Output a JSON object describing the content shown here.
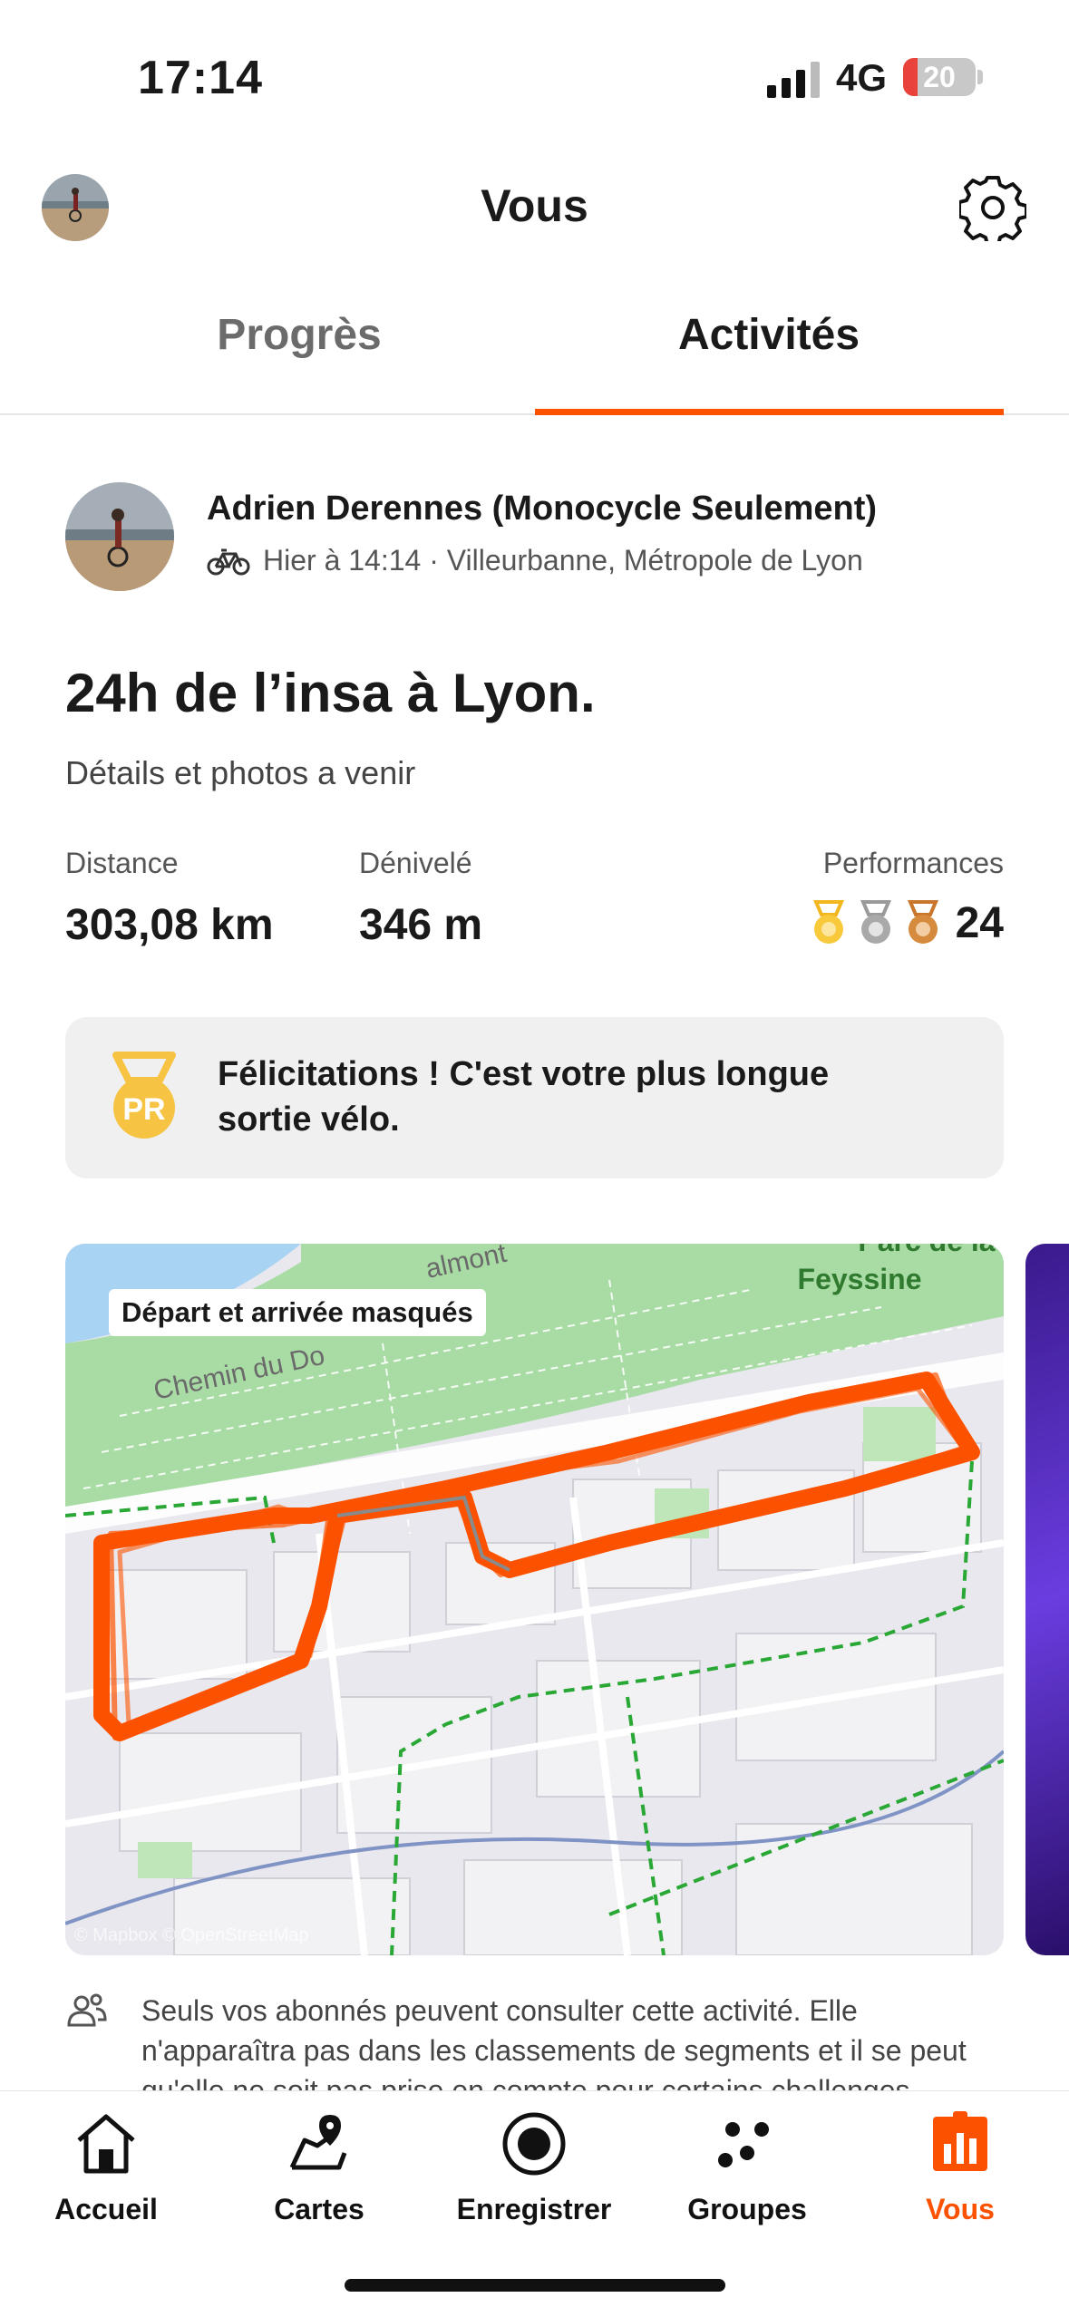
{
  "status": {
    "time": "17:14",
    "network": "4G",
    "battery": "20",
    "battery_level": 0.2
  },
  "header": {
    "title": "Vous"
  },
  "tabs": [
    {
      "label": "Progrès",
      "active": false
    },
    {
      "label": "Activités",
      "active": true
    }
  ],
  "activity": {
    "athlete": "Adrien Derennes (Monocycle Seulement)",
    "meta": "Hier à 14:14 · Villeurbanne, Métropole de Lyon",
    "title": "24h de l’insa à Lyon.",
    "description": "Détails et photos a venir",
    "stats": {
      "distance_label": "Distance",
      "distance_value": "303,08 km",
      "elevation_label": "Dénivelé",
      "elevation_value": "346 m",
      "performances_label": "Performances",
      "performances_value": "24"
    },
    "pr_banner": {
      "badge": "PR",
      "text": "Félicitations ! C'est votre plus longue sortie vélo."
    },
    "map": {
      "tag": "Départ et arrivée masqués",
      "labels": [
        "Chemin du Do",
        "almont",
        "Parc de la",
        "Feyssine"
      ],
      "attribution": "© Mapbox © OpenStreetMap"
    },
    "privacy": "Seuls vos abonnés peuvent consulter cette activité. Elle n'apparaîtra pas dans les classements de segments et il se peut qu'elle ne soit pas prise en compte pour certains challenges."
  },
  "nav": [
    {
      "label": "Accueil",
      "icon": "home-icon",
      "active": false
    },
    {
      "label": "Cartes",
      "icon": "map-icon",
      "active": false
    },
    {
      "label": "Enregistrer",
      "icon": "record-icon",
      "active": false
    },
    {
      "label": "Groupes",
      "icon": "groups-icon",
      "active": false
    },
    {
      "label": "Vous",
      "icon": "you-icon",
      "active": true
    }
  ],
  "colors": {
    "accent": "#fc5200",
    "map_green": "#a8dfa6",
    "route": "#fc5200"
  }
}
